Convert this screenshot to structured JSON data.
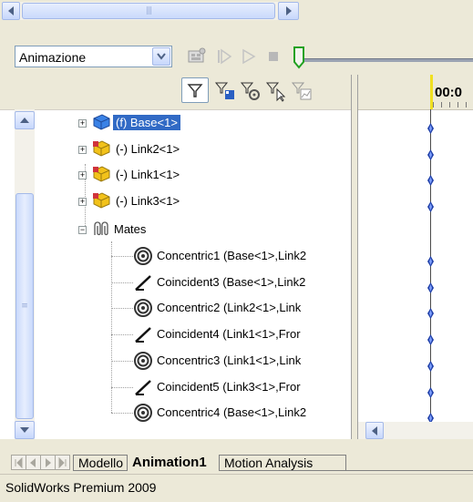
{
  "animation_mode": {
    "selected": "Animazione"
  },
  "timeline": {
    "time_label": "00:0"
  },
  "tree": {
    "components": [
      {
        "label": "(f) Base<1>",
        "selected": true
      },
      {
        "label": "(-) Link2<1>",
        "selected": false
      },
      {
        "label": "(-) Link1<1>",
        "selected": false
      },
      {
        "label": "(-) Link3<1>",
        "selected": false
      }
    ],
    "mates_label": "Mates",
    "mates": [
      {
        "type": "concentric",
        "label": "Concentric1 (Base<1>,Link2"
      },
      {
        "type": "coincident",
        "label": "Coincident3 (Base<1>,Link2"
      },
      {
        "type": "concentric",
        "label": "Concentric2 (Link2<1>,Link"
      },
      {
        "type": "coincident",
        "label": "Coincident4 (Link1<1>,Fror"
      },
      {
        "type": "concentric",
        "label": "Concentric3 (Link1<1>,Link"
      },
      {
        "type": "coincident",
        "label": "Coincident5 (Link3<1>,Fror"
      },
      {
        "type": "concentric",
        "label": "Concentric4 (Base<1>,Link2"
      }
    ]
  },
  "tabs": [
    {
      "label": "Modello",
      "active": false
    },
    {
      "label": "Animation1",
      "active": true
    },
    {
      "label": "Motion Analysis",
      "active": false
    }
  ],
  "status_bar": {
    "text": "SolidWorks Premium 2009"
  },
  "colors": {
    "selection": "#316ac5",
    "keypoint": "#1f3fa8",
    "playhead": "#f0e020"
  }
}
